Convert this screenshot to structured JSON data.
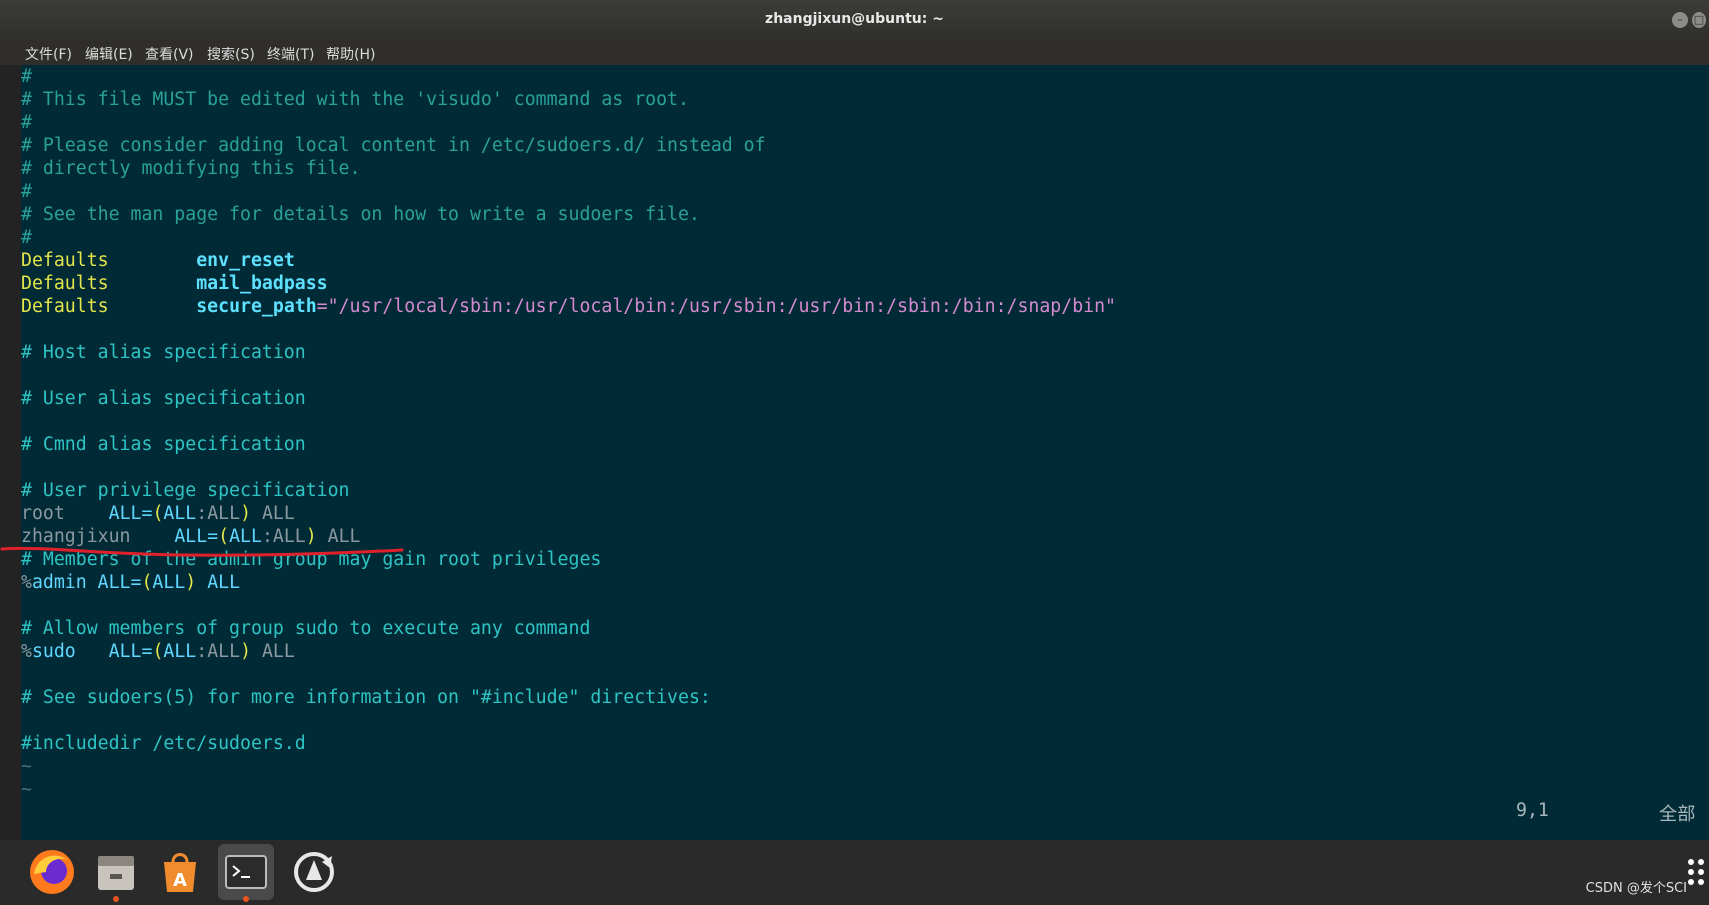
{
  "window": {
    "title": "zhangjixun@ubuntu: ~",
    "menu": [
      "文件(F)",
      "编辑(E)",
      "查看(V)",
      "搜索(S)",
      "终端(T)",
      "帮助(H)"
    ]
  },
  "terminal": {
    "lines": {
      "l1": "#",
      "l2": "# This file MUST be edited with the 'visudo' command as root.",
      "l3": "#",
      "l4": "# Please consider adding local content in /etc/sudoers.d/ instead of",
      "l5": "# directly modifying this file.",
      "l6": "#",
      "l7": "# See the man page for details on how to write a sudoers file.",
      "l8": "#",
      "defaults_kw": "Defaults",
      "env_reset": "env_reset",
      "mail_badpass": "mail_badpass",
      "secure_path_key": "secure_path",
      "eq": "=",
      "secure_path_val": "\"/usr/local/sbin:/usr/local/bin:/usr/sbin:/usr/bin:/sbin:/bin:/snap/bin\"",
      "host_alias": "# Host alias specification",
      "user_alias": "# User alias specification",
      "cmnd_alias": "# Cmnd alias specification",
      "priv_spec": "# User privilege specification",
      "root_user": "root",
      "zhang_user": "zhangjixun",
      "ALL_eq": "ALL=",
      "paren_open": "(",
      "ALL": "ALL",
      "colon_all": ":ALL",
      "paren_close": ")",
      "tail_all": " ALL",
      "admin_comment": "# Members of the admin group may gain root privileges",
      "admin_pct": "%",
      "admin_word": "admin",
      "sudo_comment": "# Allow members of group sudo to execute any command",
      "sudo_word": "sudo",
      "include_comment": "# See sudoers(5) for more information on \"#include\" directives:",
      "includedir": "#includedir /etc/sudoers.d",
      "tilde": "~"
    },
    "status": {
      "position": "9,1",
      "scope": "全部"
    }
  },
  "dock": {
    "apps": [
      "firefox-icon",
      "files-icon",
      "software-center-icon",
      "terminal-icon",
      "software-updater-icon"
    ]
  },
  "watermark": "CSDN @发个SCI"
}
